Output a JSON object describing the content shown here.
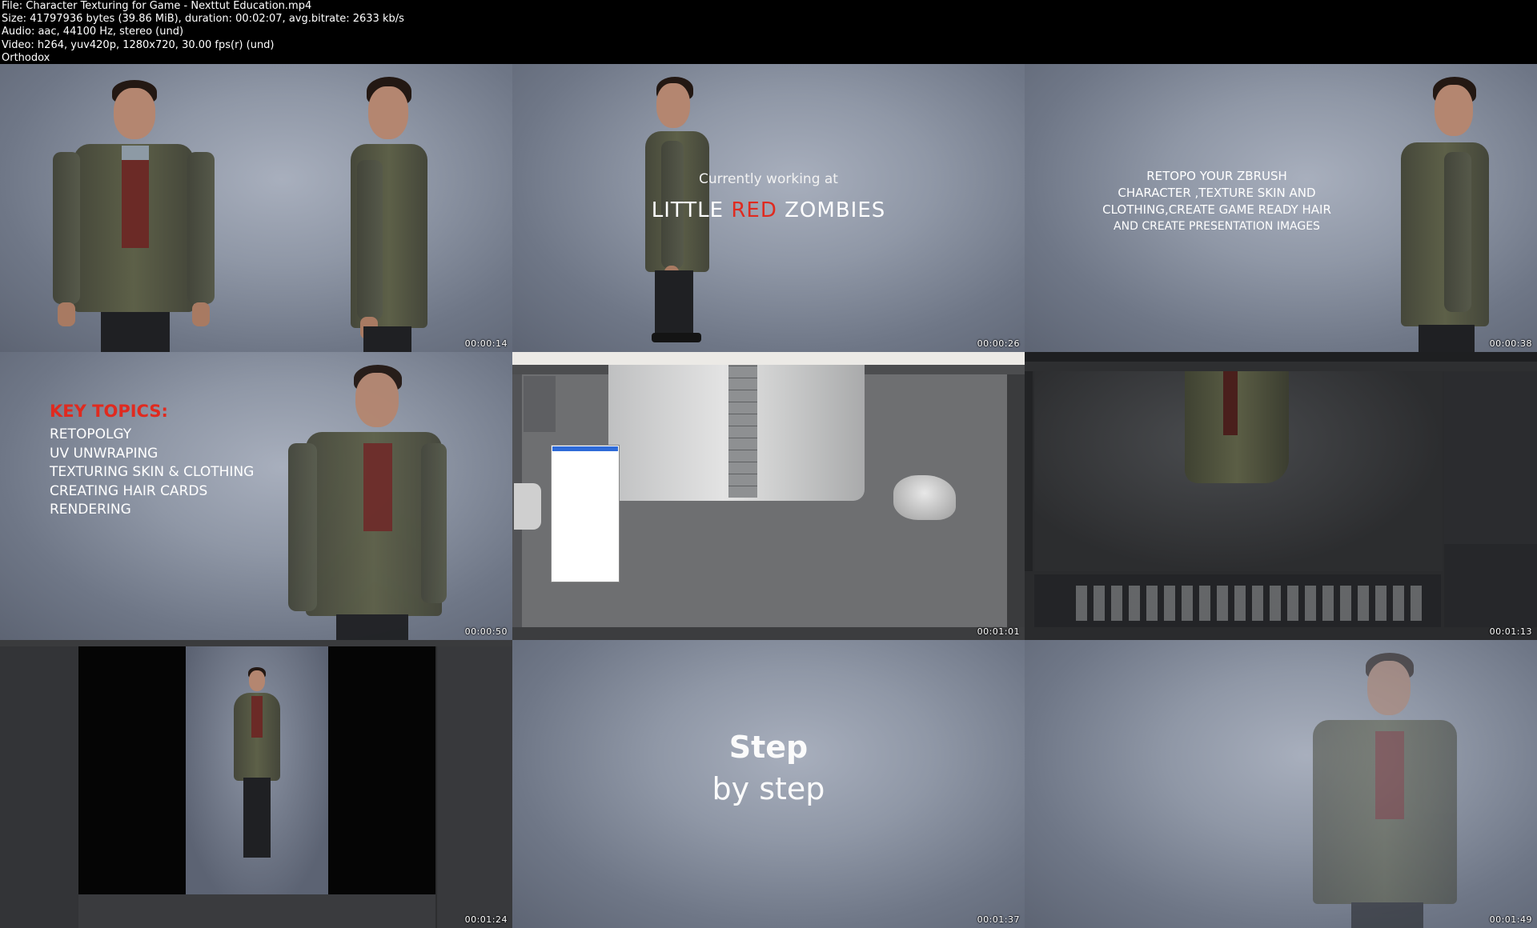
{
  "file_info": {
    "file_line": "File: Character Texturing for Game - Nexttut Education.mp4",
    "size_line": "Size: 41797936 bytes (39.86 MiB), duration: 00:02:07, avg.bitrate: 2633 kb/s",
    "audio_line": "Audio: aac, 44100 Hz, stereo (und)",
    "video_line": "Video: h264, yuv420p, 1280x720, 30.00 fps(r) (und)",
    "tag_line": "Orthodox"
  },
  "tiles": [
    {
      "timestamp": "00:00:14"
    },
    {
      "timestamp": "00:00:26",
      "subtitle": "Currently working at",
      "brand_part1": "LITTLE ",
      "brand_part2": "RED",
      "brand_part3": " ZOMBIES"
    },
    {
      "timestamp": "00:00:38",
      "lines": [
        "RETOPO YOUR ZBRUSH",
        "CHARACTER ,TEXTURE SKIN AND",
        "CLOTHING,CREATE GAME READY HAIR",
        "AND CREATE PRESENTATION IMAGES"
      ]
    },
    {
      "timestamp": "00:00:50",
      "key_title": "KEY TOPICS:",
      "key_items": [
        "RETOPOLGY",
        "UV UNWRAPING",
        "TEXTURING SKIN & CLOTHING",
        "CREATING HAIR CARDS",
        "RENDERING"
      ]
    },
    {
      "timestamp": "00:01:01"
    },
    {
      "timestamp": "00:01:13"
    },
    {
      "timestamp": "00:01:24"
    },
    {
      "timestamp": "00:01:37",
      "line1": "Step",
      "line2": "by step"
    },
    {
      "timestamp": "00:01:49"
    }
  ],
  "colors": {
    "accent_red": "#e02a1f",
    "studio_bg": "#8f97a6"
  }
}
